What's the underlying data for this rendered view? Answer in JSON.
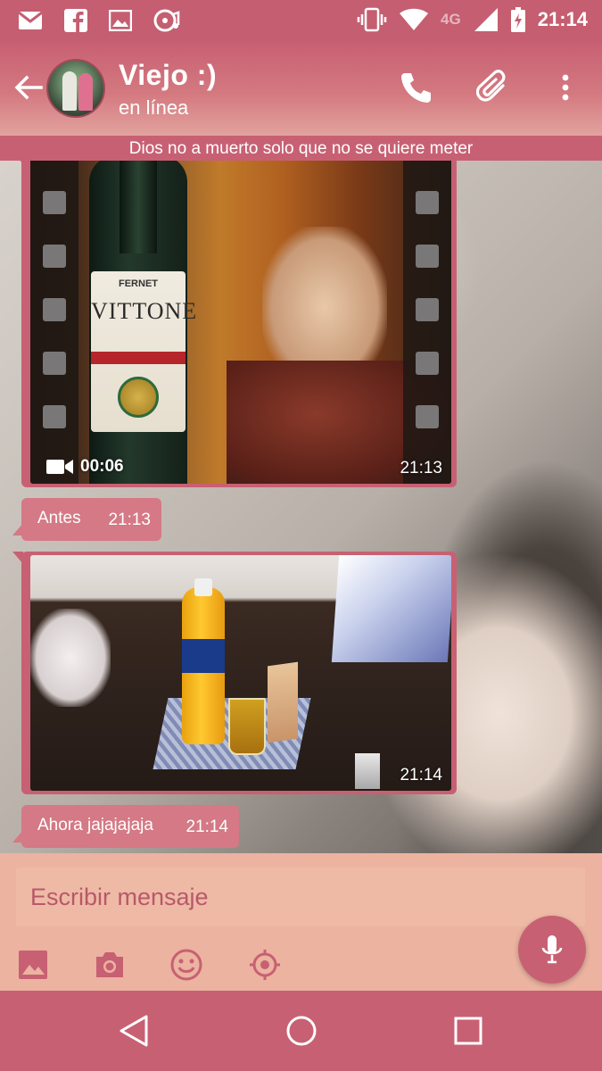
{
  "status_bar": {
    "time": "21:14",
    "network": "4G",
    "left_icons": [
      "gmail-icon",
      "facebook-icon",
      "image-icon",
      "music-icon"
    ],
    "right_icons": [
      "vibrate-icon",
      "wifi-icon",
      "signal-icon",
      "battery-charging-icon"
    ]
  },
  "header": {
    "contact_name": "Viejo :)",
    "contact_status": "en línea",
    "icons": [
      "back-arrow-icon",
      "phone-icon",
      "attach-icon",
      "more-vert-icon"
    ]
  },
  "banner": {
    "text": "Dios no a muerto solo que no se quiere meter"
  },
  "messages": [
    {
      "type": "video",
      "duration": "00:06",
      "time": "21:13",
      "label_text": "VITTONE",
      "label_sub": "FERNET"
    },
    {
      "type": "text",
      "text": "Antes",
      "time": "21:13"
    },
    {
      "type": "photo",
      "time": "21:14"
    },
    {
      "type": "text",
      "text": "Ahora jajajajaja",
      "time": "21:14"
    }
  ],
  "composer": {
    "placeholder": "Escribir mensaje",
    "tools": [
      "gallery-icon",
      "camera-icon",
      "emoji-icon",
      "location-icon"
    ],
    "send_icon": "mic-icon"
  },
  "nav_bar": {
    "buttons": [
      "back-icon",
      "home-icon",
      "recents-icon"
    ]
  },
  "colors": {
    "accent": "#c86073",
    "bubble": "#d47985",
    "composer_bg": "#ebb3a0"
  }
}
